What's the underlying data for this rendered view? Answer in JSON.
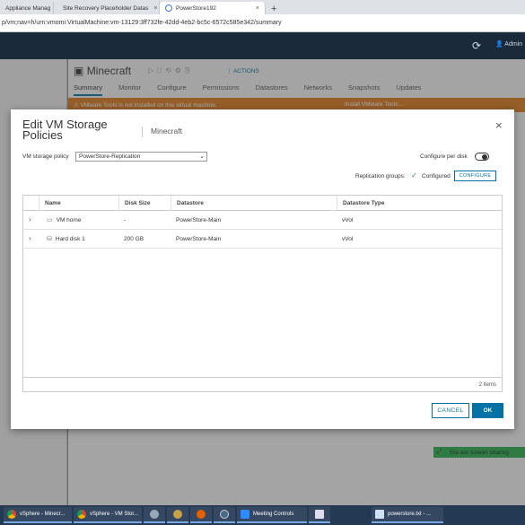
{
  "browser": {
    "tabs": [
      {
        "label": "Appliance Manag",
        "active": false
      },
      {
        "label": "Site Recovery Placeholder Datas",
        "active": false
      },
      {
        "label": "PowerStore192",
        "active": true
      }
    ],
    "new_tab": "+",
    "url": "p/vm;nav=h/urn:vmomi:VirtualMachine:vm-13129:3ff732fe-42dd-4eb2-bc5c-6572c585e342/summary"
  },
  "header": {
    "refresh_icon": "⟳",
    "user_label": "Admin"
  },
  "background": {
    "vm_name": "Minecraft",
    "actions_label": "ACTIONS",
    "tabs": [
      "Summary",
      "Monitor",
      "Configure",
      "Permissions",
      "Datastores",
      "Networks",
      "Snapshots",
      "Updates"
    ],
    "warning_text": "VMware Tools is not installed on this virtual machine.",
    "install_link": "Install VMware Tools..."
  },
  "modal": {
    "title": "Edit VM Storage Policies",
    "subtitle": "Minecraft",
    "close_icon": "×",
    "policy_label": "VM storage policy",
    "policy_value": "PowerStore-Replication",
    "configure_per_disk_label": "Configure per disk",
    "configure_per_disk_on": false,
    "replication_label": "Replication groups:",
    "replication_status": "Configured",
    "configure_button": "CONFIGURE",
    "table": {
      "columns": [
        "Name",
        "Disk Size",
        "Datastore",
        "Datastore Type"
      ],
      "rows": [
        {
          "name": "VM home",
          "icon": "folder-icon",
          "size": "-",
          "datastore": "PowerStore-Main",
          "type": "vVol"
        },
        {
          "name": "Hard disk 1",
          "icon": "disk-icon",
          "size": "200 GB",
          "datastore": "PowerStore-Main",
          "type": "vVol"
        }
      ],
      "footer": "2 items"
    },
    "cancel_button": "CANCEL",
    "ok_button": "OK"
  },
  "screen_share": "You are screen sharing",
  "taskbar": [
    {
      "label": "vSphere - Minecr...",
      "icon": "chrome-icon"
    },
    {
      "label": "vSphere - VM Stor...",
      "icon": "chrome-icon"
    },
    {
      "label": "",
      "icon": "app-icon"
    },
    {
      "label": "",
      "icon": "app-icon"
    },
    {
      "label": "",
      "icon": "firefox-icon"
    },
    {
      "label": "",
      "icon": "app-icon"
    },
    {
      "label": "Meeting Controls",
      "icon": "zoom-icon"
    },
    {
      "label": "",
      "icon": "app-icon"
    },
    {
      "label": "powerstore.txt - ...",
      "icon": "notepad-icon"
    }
  ]
}
